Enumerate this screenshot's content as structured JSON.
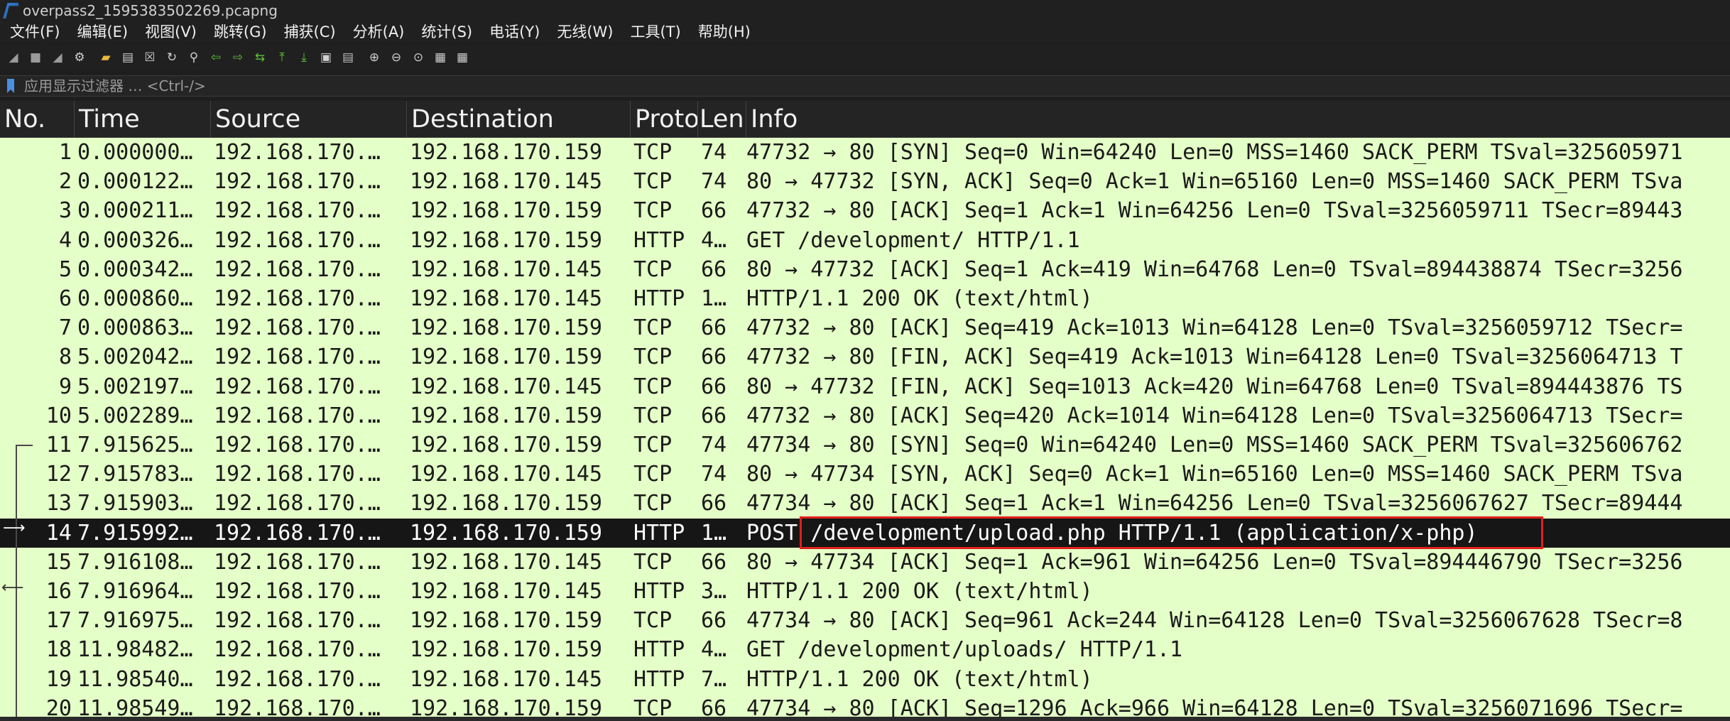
{
  "window": {
    "title": "overpass2_1595383502269.pcapng"
  },
  "menu": [
    "文件(F)",
    "编辑(E)",
    "视图(V)",
    "跳转(G)",
    "捕获(C)",
    "分析(A)",
    "统计(S)",
    "电话(Y)",
    "无线(W)",
    "工具(T)",
    "帮助(H)"
  ],
  "toolbar": [
    {
      "icon": "shark-fin-start-icon",
      "glyph": "◢",
      "color": "#9a9a9a"
    },
    {
      "icon": "stop-capture-icon",
      "glyph": "■",
      "color": "#9a9a9a"
    },
    {
      "icon": "restart-capture-icon",
      "glyph": "◢",
      "color": "#9a9a9a"
    },
    {
      "icon": "capture-options-icon",
      "glyph": "⚙",
      "color": "#cfcfcf"
    },
    {
      "icon": "open-file-icon",
      "glyph": "▰",
      "color": "#e8b83a"
    },
    {
      "icon": "save-file-icon",
      "glyph": "▤",
      "color": "#cfcfcf"
    },
    {
      "icon": "close-file-icon",
      "glyph": "☒",
      "color": "#cfcfcf"
    },
    {
      "icon": "reload-file-icon",
      "glyph": "↻",
      "color": "#cfcfcf"
    },
    {
      "icon": "find-packet-icon",
      "glyph": "⚲",
      "color": "#cfcfcf"
    },
    {
      "icon": "go-back-icon",
      "glyph": "⇦",
      "color": "#5cc13a"
    },
    {
      "icon": "go-forward-icon",
      "glyph": "⇨",
      "color": "#5cc13a"
    },
    {
      "icon": "go-to-packet-icon",
      "glyph": "⇆",
      "color": "#5cc13a"
    },
    {
      "icon": "go-first-packet-icon",
      "glyph": "⤒",
      "color": "#5cc13a"
    },
    {
      "icon": "go-last-packet-icon",
      "glyph": "⤓",
      "color": "#5cc13a"
    },
    {
      "icon": "autoscroll-icon",
      "glyph": "▣",
      "color": "#cfcfcf"
    },
    {
      "icon": "colorize-icon",
      "glyph": "▤",
      "color": "#bdbdbd"
    },
    {
      "icon": "zoom-in-icon",
      "glyph": "⊕",
      "color": "#cfcfcf"
    },
    {
      "icon": "zoom-out-icon",
      "glyph": "⊖",
      "color": "#cfcfcf"
    },
    {
      "icon": "normal-size-icon",
      "glyph": "⊙",
      "color": "#cfcfcf"
    },
    {
      "icon": "resize-columns-icon",
      "glyph": "▦",
      "color": "#cfcfcf"
    },
    {
      "icon": "layout-icon",
      "glyph": "▦",
      "color": "#cfcfcf"
    }
  ],
  "filter": {
    "placeholder": "应用显示过滤器 … <Ctrl-/>"
  },
  "columns": [
    "No.",
    "Time",
    "Source",
    "Destination",
    "Protoc",
    "Len",
    "Info"
  ],
  "packets": [
    {
      "no": "1",
      "time": "0.000000…",
      "src": "192.168.170.…",
      "dst": "192.168.170.159",
      "proto": "TCP",
      "len": "74",
      "info": "47732 → 80 [SYN] Seq=0 Win=64240 Len=0 MSS=1460 SACK_PERM TSval=325605971"
    },
    {
      "no": "2",
      "time": "0.000122…",
      "src": "192.168.170.…",
      "dst": "192.168.170.145",
      "proto": "TCP",
      "len": "74",
      "info": "80 → 47732 [SYN, ACK] Seq=0 Ack=1 Win=65160 Len=0 MSS=1460 SACK_PERM TSva"
    },
    {
      "no": "3",
      "time": "0.000211…",
      "src": "192.168.170.…",
      "dst": "192.168.170.159",
      "proto": "TCP",
      "len": "66",
      "info": "47732 → 80 [ACK] Seq=1 Ack=1 Win=64256 Len=0 TSval=3256059711 TSecr=89443"
    },
    {
      "no": "4",
      "time": "0.000326…",
      "src": "192.168.170.…",
      "dst": "192.168.170.159",
      "proto": "HTTP",
      "len": "4…",
      "info": "GET /development/ HTTP/1.1"
    },
    {
      "no": "5",
      "time": "0.000342…",
      "src": "192.168.170.…",
      "dst": "192.168.170.145",
      "proto": "TCP",
      "len": "66",
      "info": "80 → 47732 [ACK] Seq=1 Ack=419 Win=64768 Len=0 TSval=894438874 TSecr=3256"
    },
    {
      "no": "6",
      "time": "0.000860…",
      "src": "192.168.170.…",
      "dst": "192.168.170.145",
      "proto": "HTTP",
      "len": "1…",
      "info": "HTTP/1.1 200 OK  (text/html)"
    },
    {
      "no": "7",
      "time": "0.000863…",
      "src": "192.168.170.…",
      "dst": "192.168.170.159",
      "proto": "TCP",
      "len": "66",
      "info": "47732 → 80 [ACK] Seq=419 Ack=1013 Win=64128 Len=0 TSval=3256059712 TSecr="
    },
    {
      "no": "8",
      "time": "5.002042…",
      "src": "192.168.170.…",
      "dst": "192.168.170.159",
      "proto": "TCP",
      "len": "66",
      "info": "47732 → 80 [FIN, ACK] Seq=419 Ack=1013 Win=64128 Len=0 TSval=3256064713 T"
    },
    {
      "no": "9",
      "time": "5.002197…",
      "src": "192.168.170.…",
      "dst": "192.168.170.145",
      "proto": "TCP",
      "len": "66",
      "info": "80 → 47732 [FIN, ACK] Seq=1013 Ack=420 Win=64768 Len=0 TSval=894443876 TS"
    },
    {
      "no": "10",
      "time": "5.002289…",
      "src": "192.168.170.…",
      "dst": "192.168.170.159",
      "proto": "TCP",
      "len": "66",
      "info": "47732 → 80 [ACK] Seq=420 Ack=1014 Win=64128 Len=0 TSval=3256064713 TSecr="
    },
    {
      "no": "11",
      "time": "7.915625…",
      "src": "192.168.170.…",
      "dst": "192.168.170.159",
      "proto": "TCP",
      "len": "74",
      "info": "47734 → 80 [SYN] Seq=0 Win=64240 Len=0 MSS=1460 SACK_PERM TSval=325606762"
    },
    {
      "no": "12",
      "time": "7.915783…",
      "src": "192.168.170.…",
      "dst": "192.168.170.145",
      "proto": "TCP",
      "len": "74",
      "info": "80 → 47734 [SYN, ACK] Seq=0 Ack=1 Win=65160 Len=0 MSS=1460 SACK_PERM TSva"
    },
    {
      "no": "13",
      "time": "7.915903…",
      "src": "192.168.170.…",
      "dst": "192.168.170.159",
      "proto": "TCP",
      "len": "66",
      "info": "47734 → 80 [ACK] Seq=1 Ack=1 Win=64256 Len=0 TSval=3256067627 TSecr=89444"
    },
    {
      "no": "14",
      "time": "7.915992…",
      "src": "192.168.170.…",
      "dst": "192.168.170.159",
      "proto": "HTTP",
      "len": "1…",
      "info": "POST /development/upload.php HTTP/1.1  (application/x-php)",
      "selected": true
    },
    {
      "no": "15",
      "time": "7.916108…",
      "src": "192.168.170.…",
      "dst": "192.168.170.145",
      "proto": "TCP",
      "len": "66",
      "info": "80 → 47734 [ACK] Seq=1 Ack=961 Win=64256 Len=0 TSval=894446790 TSecr=3256"
    },
    {
      "no": "16",
      "time": "7.916964…",
      "src": "192.168.170.…",
      "dst": "192.168.170.145",
      "proto": "HTTP",
      "len": "3…",
      "info": "HTTP/1.1 200 OK  (text/html)"
    },
    {
      "no": "17",
      "time": "7.916975…",
      "src": "192.168.170.…",
      "dst": "192.168.170.159",
      "proto": "TCP",
      "len": "66",
      "info": "47734 → 80 [ACK] Seq=961 Ack=244 Win=64128 Len=0 TSval=3256067628 TSecr=8"
    },
    {
      "no": "18",
      "time": "11.98482…",
      "src": "192.168.170.…",
      "dst": "192.168.170.159",
      "proto": "HTTP",
      "len": "4…",
      "info": "GET /development/uploads/ HTTP/1.1"
    },
    {
      "no": "19",
      "time": "11.98540…",
      "src": "192.168.170.…",
      "dst": "192.168.170.145",
      "proto": "HTTP",
      "len": "7…",
      "info": "HTTP/1.1 200 OK  (text/html)"
    },
    {
      "no": "20",
      "time": "11.98549…",
      "src": "192.168.170.…",
      "dst": "192.168.170.159",
      "proto": "TCP",
      "len": "66",
      "info": "47734 → 80 [ACK] Seq=1296 Ack=966 Win=64128 Len=0 TSval=3256071696 TSecr="
    }
  ],
  "colors": {
    "row_bg": "#e4ffc7",
    "selected_bg": "#161616",
    "highlight_box": "#e0201b"
  }
}
